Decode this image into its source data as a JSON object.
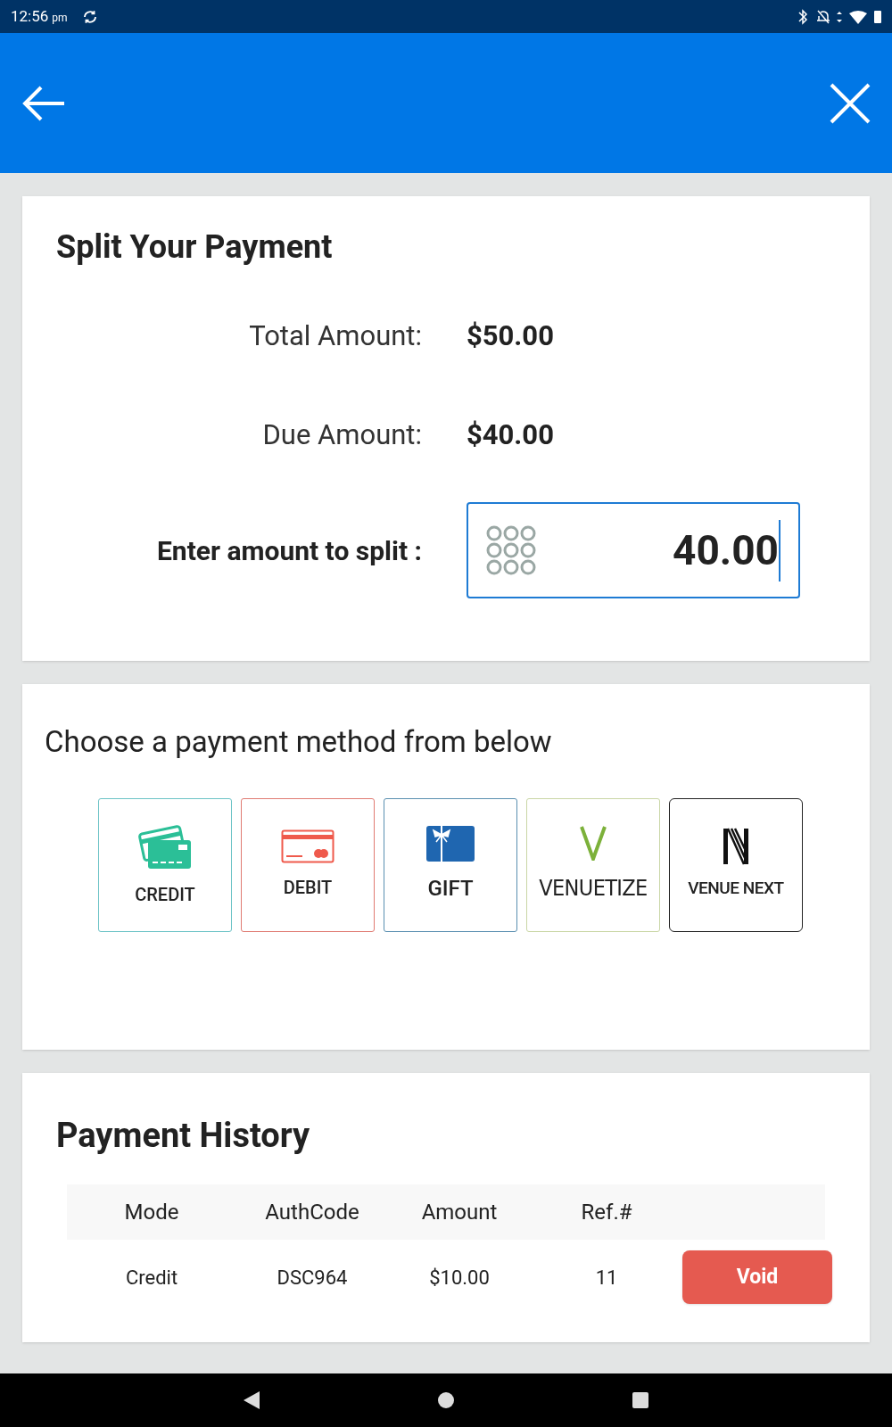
{
  "status_bar": {
    "time": "12:56",
    "ampm": "pm"
  },
  "split": {
    "title": "Split Your Payment",
    "total_label": "Total Amount:",
    "total_value": "$50.00",
    "due_label": "Due Amount:",
    "due_value": "$40.00",
    "enter_label": "Enter amount to split :",
    "amount_value": "40.00"
  },
  "methods": {
    "prompt": "Choose a payment method from below",
    "items": [
      {
        "kind": "credit",
        "label": "CREDIT",
        "color": "#6cc3c6"
      },
      {
        "kind": "debit",
        "label": "DEBIT",
        "color": "#e07b72"
      },
      {
        "kind": "gift",
        "label": "GIFT",
        "color": "#5a8fb0"
      },
      {
        "kind": "venuetize",
        "label": "VENUETIZE",
        "color": "#c9d6a5"
      },
      {
        "kind": "venuenext",
        "label": "VENUE NEXT",
        "color": "#222222"
      }
    ]
  },
  "history": {
    "title": "Payment History",
    "columns": [
      "Mode",
      "AuthCode",
      "Amount",
      "Ref.#"
    ],
    "rows": [
      {
        "cells": [
          "Credit",
          "DSC964",
          "$10.00",
          "11"
        ],
        "action": "Void"
      }
    ]
  }
}
